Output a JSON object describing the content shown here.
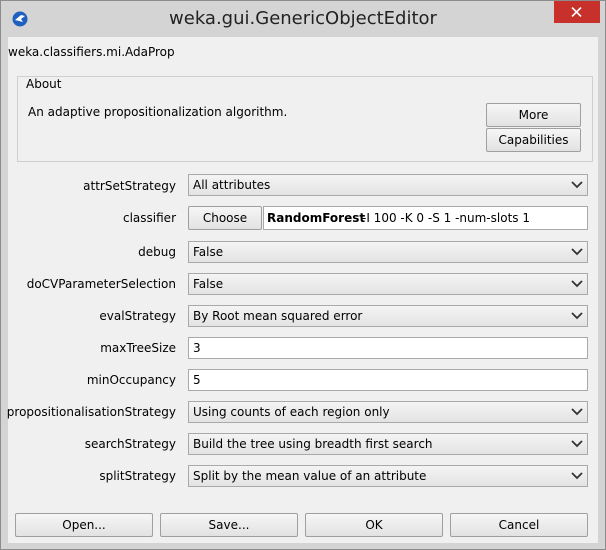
{
  "window": {
    "title": "weka.gui.GenericObjectEditor",
    "class_name": "weka.classifiers.mi.AdaProp"
  },
  "about": {
    "legend": "About",
    "description": "An adaptive propositionalization algorithm.",
    "more_label": "More",
    "capabilities_label": "Capabilities"
  },
  "properties": {
    "attrSetStrategy": {
      "label": "attrSetStrategy",
      "value": "All attributes"
    },
    "classifier": {
      "label": "classifier",
      "choose_label": "Choose",
      "name": "RandomForest",
      "options": "-I 100 -K 0 -S 1 -num-slots 1"
    },
    "debug": {
      "label": "debug",
      "value": "False"
    },
    "doCVParameterSelection": {
      "label": "doCVParameterSelection",
      "value": "False"
    },
    "evalStrategy": {
      "label": "evalStrategy",
      "value": "By Root mean squared error"
    },
    "maxTreeSize": {
      "label": "maxTreeSize",
      "value": "3"
    },
    "minOccupancy": {
      "label": "minOccupancy",
      "value": "5"
    },
    "propositionalisationStrategy": {
      "label": "propositionalisationStrategy",
      "value": "Using counts of each region only"
    },
    "searchStrategy": {
      "label": "searchStrategy",
      "value": "Build the tree using breadth first search"
    },
    "splitStrategy": {
      "label": "splitStrategy",
      "value": "Split by the mean value of an attribute"
    }
  },
  "footer": {
    "open_label": "Open...",
    "save_label": "Save...",
    "ok_label": "OK",
    "cancel_label": "Cancel"
  },
  "icons": {
    "app": "weka-bird-icon",
    "close": "close-icon",
    "dropdown": "chevron-down-icon"
  },
  "colors": {
    "close_button": "#c7302b",
    "dialog_background": "#f0f0f0"
  }
}
